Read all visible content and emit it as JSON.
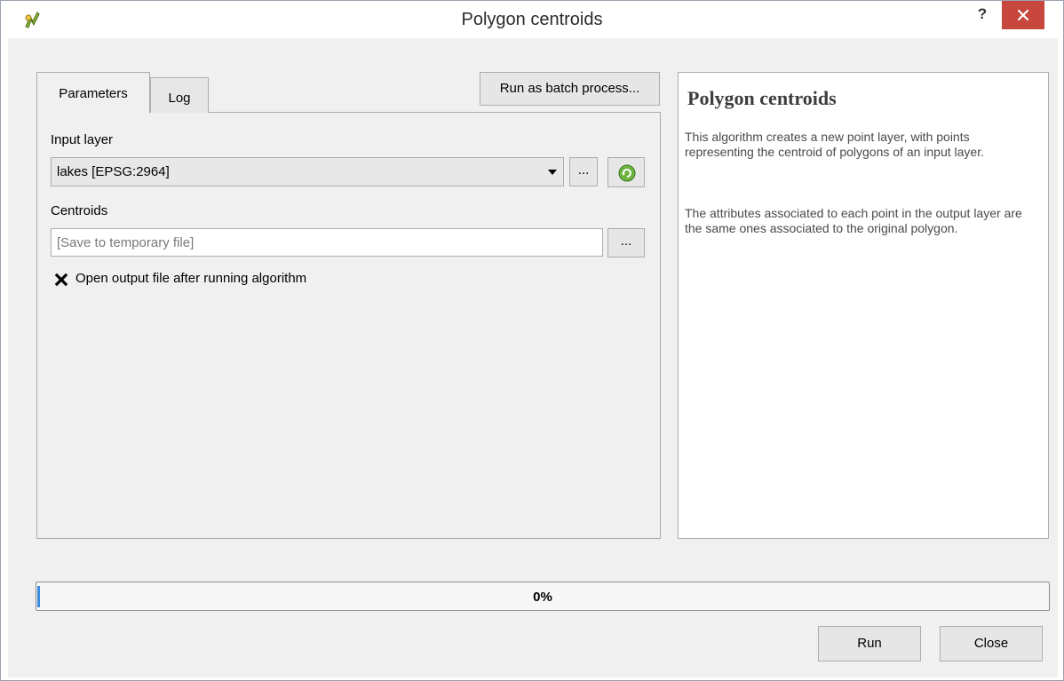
{
  "window": {
    "title": "Polygon centroids",
    "help_label": "?"
  },
  "tabs": [
    {
      "label": "Parameters",
      "active": true
    },
    {
      "label": "Log",
      "active": false
    }
  ],
  "toolbar": {
    "batch_label": "Run as batch process..."
  },
  "params": {
    "input_layer_label": "Input layer",
    "input_layer_value": "lakes [EPSG:2964]",
    "browse_label": "...",
    "centroids_label": "Centroids",
    "centroids_value": "",
    "centroids_placeholder": "[Save to temporary file]",
    "open_output_checked": true,
    "open_output_label": "Open output file after running algorithm"
  },
  "help": {
    "title": "Polygon centroids",
    "para1": "This algorithm creates a new point layer, with points representing the centroid of polygons of an input layer.",
    "para2": "The attributes associated to each point in the output layer are the same ones associated to the original polygon."
  },
  "progress": {
    "value": 0,
    "label": "0%"
  },
  "buttons": {
    "run": "Run",
    "close": "Close"
  },
  "colors": {
    "close_button": "#c7463e",
    "progress_fill": "#3b8de0"
  }
}
